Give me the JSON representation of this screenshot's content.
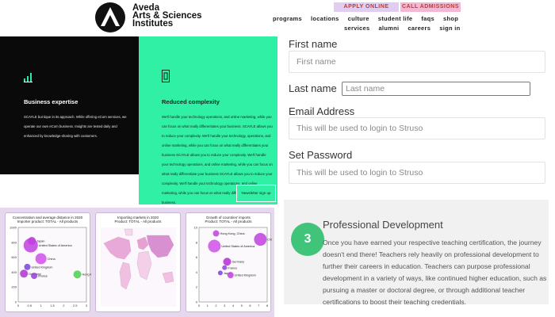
{
  "header": {
    "logo_line1": "Aveda",
    "logo_line2": "Arts & Sciences",
    "logo_line3": "Institutes",
    "apply_label": "APPLY ONLINE",
    "call_label": "CALL ADMISSIONS",
    "nav_primary": [
      "programs",
      "locations",
      "culture",
      "student life",
      "faqs",
      "shop"
    ],
    "nav_secondary": [
      "services",
      "alumni",
      "careers",
      "sign in"
    ]
  },
  "features": {
    "business": {
      "title": "Business expertise",
      "body": "SCAYLE but tique in its approach. While offering eCom services, we operate our own eCom business. Insights are tested daily and enhanced by knowledge-sharing with customers."
    },
    "complexity": {
      "title": "Reduced complexity",
      "body": "We'll handle your technology operations, and online marketing, while you can focus on what really differentiates your business. SCAYLE allows you to reduce your complexity. We'll handle your technology, operations, and online marketing, while you can focus on what really differentiates your business SCAYLE allows you to reduce your complexity. We'll handle your technology operations, and online marketing, while you can focus on what really differentiate your business SCAYLE allows you to reduce your complexity. We'll handle your technology operations, and online marketing, while you can focus on what really differentiates your business.",
      "cta": "Newsletter sign up"
    }
  },
  "form": {
    "first_name_label": "First name",
    "first_name_placeholder": "First name",
    "last_name_label": "Last name",
    "last_name_placeholder": "Last name",
    "email_label": "Email Address",
    "email_placeholder": "This will be used to login to Struso",
    "password_label": "Set Password",
    "password_placeholder": "This will be used to login to Struso"
  },
  "professional": {
    "number": "3",
    "title": "Professional Development",
    "body": "Once you have earned your respective teaching certification, the journey doesn't end there! Teachers rely heavily on professional development to further their careers in education. Teachers can purpose professional development in a variety of ways, like continued higher education, such as pursuing a master or doctoral degree, or through additional teacher certifications to boost their teaching credentials."
  },
  "chart_data": [
    {
      "type": "scatter",
      "title": "Concentration and average distance in 2020",
      "subtitle": "Importer product: TOTAL - All products",
      "ylim": [
        0,
        1000
      ],
      "xlim": [
        0,
        3
      ],
      "yticks": [
        "1000",
        "800",
        "600",
        "400",
        "200",
        "0"
      ],
      "xticks": [
        "0",
        "0.5",
        "1",
        "1.5",
        "2",
        "2.5",
        "3"
      ],
      "points": [
        {
          "label": "Japan",
          "x": 0.6,
          "y": 820,
          "r": 5,
          "color": "#c040e0"
        },
        {
          "label": "United States of America",
          "x": 0.55,
          "y": 760,
          "r": 9,
          "color": "#c040e0"
        },
        {
          "label": "China",
          "x": 1.0,
          "y": 580,
          "r": 7,
          "color": "#d050e8"
        },
        {
          "label": "United Kingdom",
          "x": 0.4,
          "y": 470,
          "r": 4,
          "color": "#7b3fe0"
        },
        {
          "label": "Germany",
          "x": 0.25,
          "y": 380,
          "r": 5,
          "color": "#b030d0"
        },
        {
          "label": "France",
          "x": 0.7,
          "y": 350,
          "r": 4,
          "color": "#9040d8"
        },
        {
          "label": "Hong Kong, China",
          "x": 2.6,
          "y": 370,
          "r": 5,
          "color": "#4ad04a"
        }
      ]
    },
    {
      "type": "map",
      "title": "Importing markets in 2020",
      "subtitle": "Product: TOTAL - All products"
    },
    {
      "type": "scatter",
      "title": "Growth of countries' imports",
      "subtitle": "Product: TOTAL - All products",
      "ylim": [
        0,
        10
      ],
      "xlim": [
        0,
        8
      ],
      "yticks": [
        "10",
        "8",
        "6",
        "4",
        "2",
        "0"
      ],
      "xticks": [
        "0",
        "1",
        "2",
        "3",
        "4",
        "5",
        "6",
        "7",
        "8"
      ],
      "points": [
        {
          "label": "Hong Kong, China",
          "x": 2.0,
          "y": 9.2,
          "r": 4,
          "color": "#c040e0"
        },
        {
          "label": "China",
          "x": 7.2,
          "y": 8.4,
          "r": 8,
          "color": "#c040e0"
        },
        {
          "label": "United States of America",
          "x": 1.8,
          "y": 7.5,
          "r": 8,
          "color": "#d050e8"
        },
        {
          "label": "Germany",
          "x": 3.3,
          "y": 5.4,
          "r": 5,
          "color": "#b030d0"
        },
        {
          "label": "France",
          "x": 3.0,
          "y": 4.6,
          "r": 3,
          "color": "#9040d8"
        },
        {
          "label": "Japan",
          "x": 2.5,
          "y": 3.9,
          "r": 3,
          "color": "#7b3fe0"
        },
        {
          "label": "United Kingdom",
          "x": 3.7,
          "y": 3.6,
          "r": 4,
          "color": "#c040e0"
        }
      ]
    }
  ]
}
